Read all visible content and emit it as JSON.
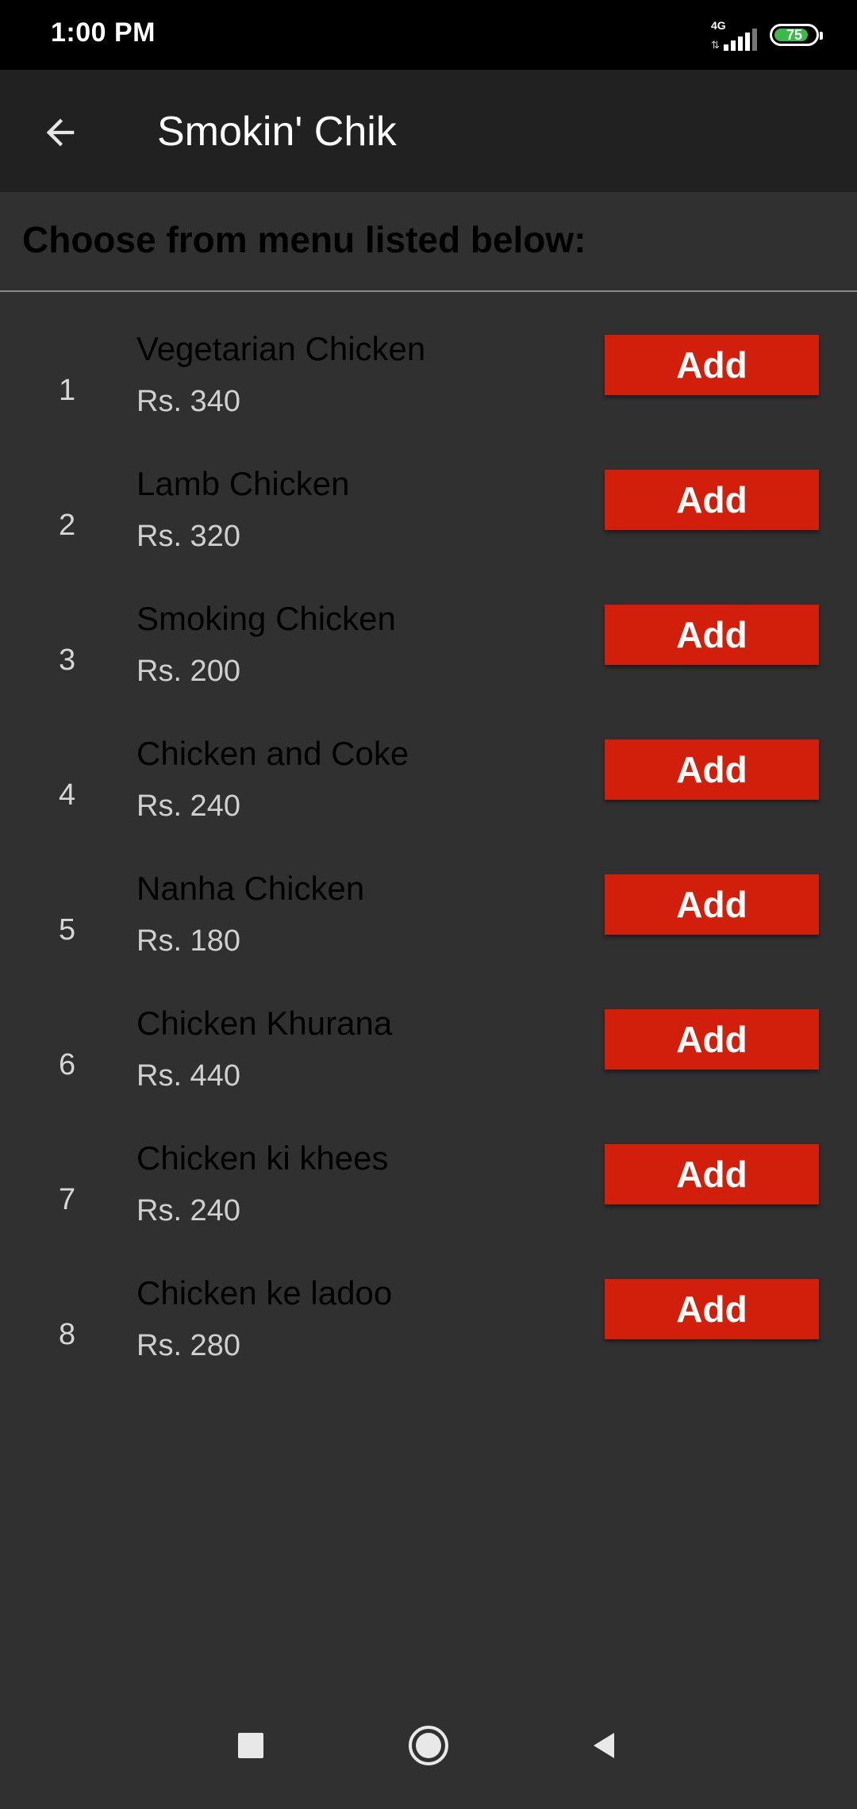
{
  "status_bar": {
    "time": "1:00 PM",
    "network": "4G",
    "battery": "75",
    "battery_level_percent": 75,
    "signal_icon": "signal-bars-icon",
    "battery_color": "#3bb94a"
  },
  "app_bar": {
    "title": "Smokin' Chik",
    "back_icon": "arrow-back-icon"
  },
  "menu": {
    "heading": "Choose from menu listed below:",
    "items": [
      {
        "index": "1",
        "name": "Vegetarian Chicken",
        "price": "Rs. 340",
        "button": "Add"
      },
      {
        "index": "2",
        "name": "Lamb Chicken",
        "price": "Rs. 320",
        "button": "Add"
      },
      {
        "index": "3",
        "name": "Smoking Chicken",
        "price": "Rs. 200",
        "button": "Add"
      },
      {
        "index": "4",
        "name": "Chicken and Coke",
        "price": "Rs. 240",
        "button": "Add"
      },
      {
        "index": "5",
        "name": "Nanha Chicken",
        "price": "Rs. 180",
        "button": "Add"
      },
      {
        "index": "6",
        "name": "Chicken Khurana",
        "price": "Rs. 440",
        "button": "Add"
      },
      {
        "index": "7",
        "name": "Chicken ki khees",
        "price": "Rs. 240",
        "button": "Add"
      },
      {
        "index": "8",
        "name": "Chicken ke ladoo",
        "price": "Rs. 280",
        "button": "Add"
      }
    ]
  },
  "nav_bar": {
    "recents_icon": "square-recents-icon",
    "home_icon": "circle-home-icon",
    "back_icon": "triangle-back-icon"
  },
  "colors": {
    "accent": "#d21f0b",
    "background": "#303030",
    "app_bar": "#212121"
  }
}
